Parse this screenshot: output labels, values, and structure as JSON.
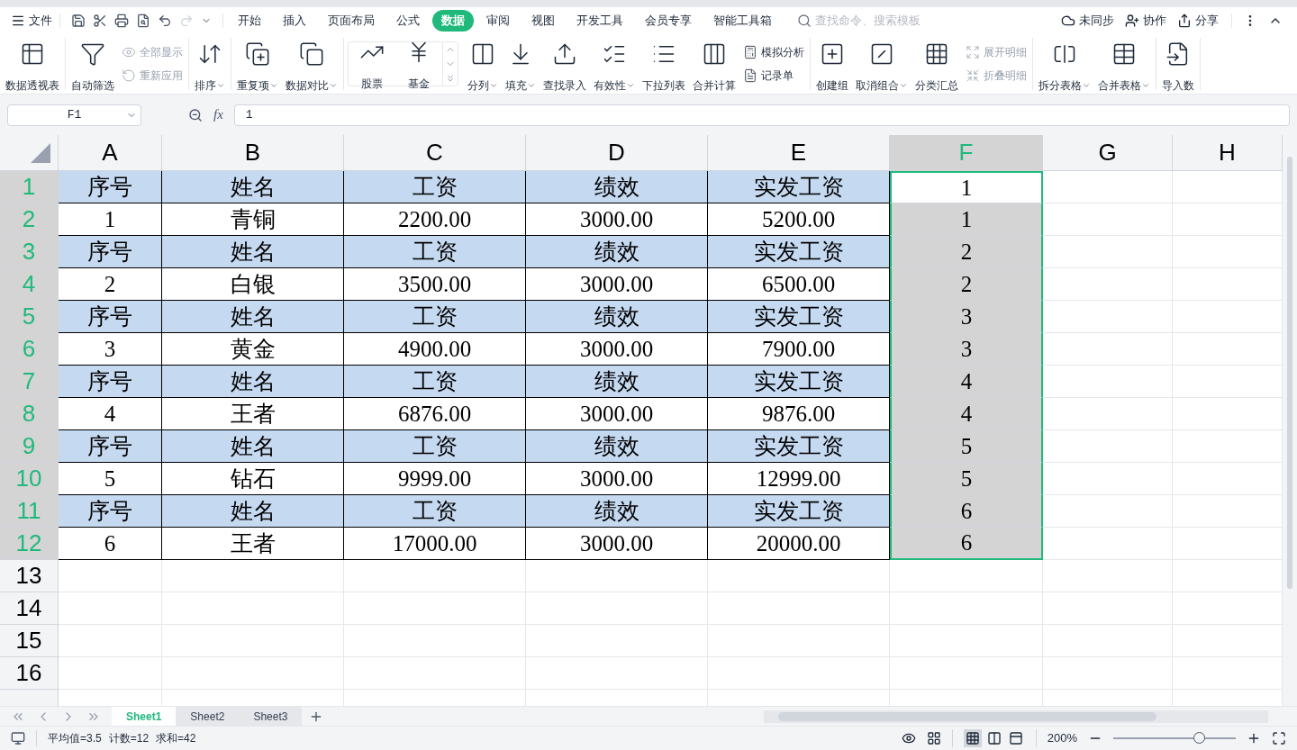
{
  "menu": {
    "file": "文件",
    "tabs": [
      {
        "label": "开始",
        "selected": false
      },
      {
        "label": "插入",
        "selected": false
      },
      {
        "label": "页面布局",
        "selected": false
      },
      {
        "label": "公式",
        "selected": false
      },
      {
        "label": "数据",
        "selected": true
      },
      {
        "label": "审阅",
        "selected": false
      },
      {
        "label": "视图",
        "selected": false
      },
      {
        "label": "开发工具",
        "selected": false
      },
      {
        "label": "会员专享",
        "selected": false
      },
      {
        "label": "智能工具箱",
        "selected": false
      }
    ],
    "search": {
      "placeholder": "查找命令、搜索模板"
    },
    "actions": [
      "未同步",
      "协作",
      "分享"
    ]
  },
  "ribbon": [
    {
      "kind": "normal",
      "items": [
        {
          "kind": "large",
          "label": "数据透视表",
          "dropdown": false,
          "disabled": false
        }
      ]
    },
    {
      "kind": "normal",
      "items": [
        {
          "kind": "large",
          "label": "自动筛选",
          "dropdown": false,
          "disabled": false
        },
        {
          "kind": "small",
          "label": "全部显示",
          "dropdown": false,
          "disabled": true
        },
        {
          "kind": "small",
          "label": "重新应用",
          "dropdown": false,
          "disabled": true
        }
      ]
    },
    {
      "kind": "normal",
      "items": [
        {
          "kind": "large",
          "label": "排序",
          "dropdown": true,
          "disabled": false
        }
      ]
    },
    {
      "kind": "normal",
      "items": [
        {
          "kind": "large",
          "label": "重复项",
          "dropdown": true,
          "disabled": false
        },
        {
          "kind": "large",
          "label": "数据对比",
          "dropdown": true,
          "disabled": false
        }
      ]
    },
    {
      "kind": "gallery",
      "items": [
        {
          "kind": "large",
          "label": "股票",
          "dropdown": false,
          "disabled": false
        },
        {
          "kind": "large",
          "label": "基金",
          "dropdown": false,
          "disabled": false
        }
      ]
    },
    {
      "kind": "normal",
      "items": [
        {
          "kind": "large",
          "label": "分列",
          "dropdown": true,
          "disabled": false
        },
        {
          "kind": "large",
          "label": "填充",
          "dropdown": true,
          "disabled": false
        },
        {
          "kind": "large",
          "label": "查找录入",
          "dropdown": false,
          "disabled": false
        },
        {
          "kind": "large",
          "label": "有效性",
          "dropdown": true,
          "disabled": false
        },
        {
          "kind": "large",
          "label": "下拉列表",
          "dropdown": false,
          "disabled": false
        },
        {
          "kind": "large",
          "label": "合并计算",
          "dropdown": false,
          "disabled": false
        },
        {
          "kind": "small",
          "label": "模拟分析",
          "dropdown": false,
          "disabled": false
        },
        {
          "kind": "small",
          "label": "记录单",
          "dropdown": false,
          "disabled": false
        }
      ]
    },
    {
      "kind": "normal",
      "items": [
        {
          "kind": "large",
          "label": "创建组",
          "dropdown": false,
          "disabled": false
        },
        {
          "kind": "large",
          "label": "取消组合",
          "dropdown": true,
          "disabled": false
        },
        {
          "kind": "large",
          "label": "分类汇总",
          "dropdown": false,
          "disabled": false
        },
        {
          "kind": "small",
          "label": "展开明细",
          "dropdown": false,
          "disabled": true
        },
        {
          "kind": "small",
          "label": "折叠明细",
          "dropdown": false,
          "disabled": true
        }
      ]
    },
    {
      "kind": "normal",
      "items": [
        {
          "kind": "large",
          "label": "拆分表格",
          "dropdown": true,
          "disabled": false
        },
        {
          "kind": "large",
          "label": "合并表格",
          "dropdown": true,
          "disabled": false
        }
      ]
    },
    {
      "kind": "normal",
      "items": [
        {
          "kind": "large",
          "label": "导入数",
          "dropdown": false,
          "disabled": false
        }
      ]
    }
  ],
  "formula_bar": {
    "name_box": "F1",
    "fx": "fx",
    "value": "1"
  },
  "columns": [
    {
      "label": "A",
      "selected": false
    },
    {
      "label": "B",
      "selected": false
    },
    {
      "label": "C",
      "selected": false
    },
    {
      "label": "D",
      "selected": false
    },
    {
      "label": "E",
      "selected": false
    },
    {
      "label": "F",
      "selected": true
    },
    {
      "label": "G",
      "selected": false
    },
    {
      "label": "H",
      "selected": false
    }
  ],
  "rows": [
    {
      "label": "1",
      "kind": "header",
      "selected": true,
      "active": true,
      "cells": [
        "序号",
        "姓名",
        "工资",
        "绩效",
        "实发工资",
        "1"
      ]
    },
    {
      "label": "2",
      "kind": "data",
      "selected": true,
      "active": false,
      "cells": [
        "1",
        "青铜",
        "2200.00",
        "3000.00",
        "5200.00",
        "1"
      ]
    },
    {
      "label": "3",
      "kind": "header",
      "selected": true,
      "active": false,
      "cells": [
        "序号",
        "姓名",
        "工资",
        "绩效",
        "实发工资",
        "2"
      ]
    },
    {
      "label": "4",
      "kind": "data",
      "selected": true,
      "active": false,
      "cells": [
        "2",
        "白银",
        "3500.00",
        "3000.00",
        "6500.00",
        "2"
      ]
    },
    {
      "label": "5",
      "kind": "header",
      "selected": true,
      "active": false,
      "cells": [
        "序号",
        "姓名",
        "工资",
        "绩效",
        "实发工资",
        "3"
      ]
    },
    {
      "label": "6",
      "kind": "data",
      "selected": true,
      "active": false,
      "cells": [
        "3",
        "黄金",
        "4900.00",
        "3000.00",
        "7900.00",
        "3"
      ]
    },
    {
      "label": "7",
      "kind": "header",
      "selected": true,
      "active": false,
      "cells": [
        "序号",
        "姓名",
        "工资",
        "绩效",
        "实发工资",
        "4"
      ]
    },
    {
      "label": "8",
      "kind": "data",
      "selected": true,
      "active": false,
      "cells": [
        "4",
        "王者",
        "6876.00",
        "3000.00",
        "9876.00",
        "4"
      ]
    },
    {
      "label": "9",
      "kind": "header",
      "selected": true,
      "active": false,
      "cells": [
        "序号",
        "姓名",
        "工资",
        "绩效",
        "实发工资",
        "5"
      ]
    },
    {
      "label": "10",
      "kind": "data",
      "selected": true,
      "active": false,
      "cells": [
        "5",
        "钻石",
        "9999.00",
        "3000.00",
        "12999.00",
        "5"
      ]
    },
    {
      "label": "11",
      "kind": "header",
      "selected": true,
      "active": false,
      "cells": [
        "序号",
        "姓名",
        "工资",
        "绩效",
        "实发工资",
        "6"
      ]
    },
    {
      "label": "12",
      "kind": "data",
      "selected": true,
      "active": false,
      "cells": [
        "6",
        "王者",
        "17000.00",
        "3000.00",
        "20000.00",
        "6"
      ]
    },
    {
      "label": "13",
      "kind": "empty",
      "selected": false,
      "cells": []
    },
    {
      "label": "14",
      "kind": "empty",
      "selected": false,
      "cells": []
    },
    {
      "label": "15",
      "kind": "empty",
      "selected": false,
      "cells": []
    },
    {
      "label": "16",
      "kind": "empty",
      "selected": false,
      "cells": []
    }
  ],
  "sheets": [
    {
      "label": "Sheet1",
      "selected": true
    },
    {
      "label": "Sheet2",
      "selected": false
    },
    {
      "label": "Sheet3",
      "selected": false
    }
  ],
  "status": [
    "平均值=3.5",
    "计数=12",
    "求和=42"
  ],
  "view_modes": [
    {
      "selected": true
    },
    {
      "selected": false
    },
    {
      "selected": false
    }
  ],
  "zoom": {
    "text": "200%",
    "level": 0.7
  }
}
